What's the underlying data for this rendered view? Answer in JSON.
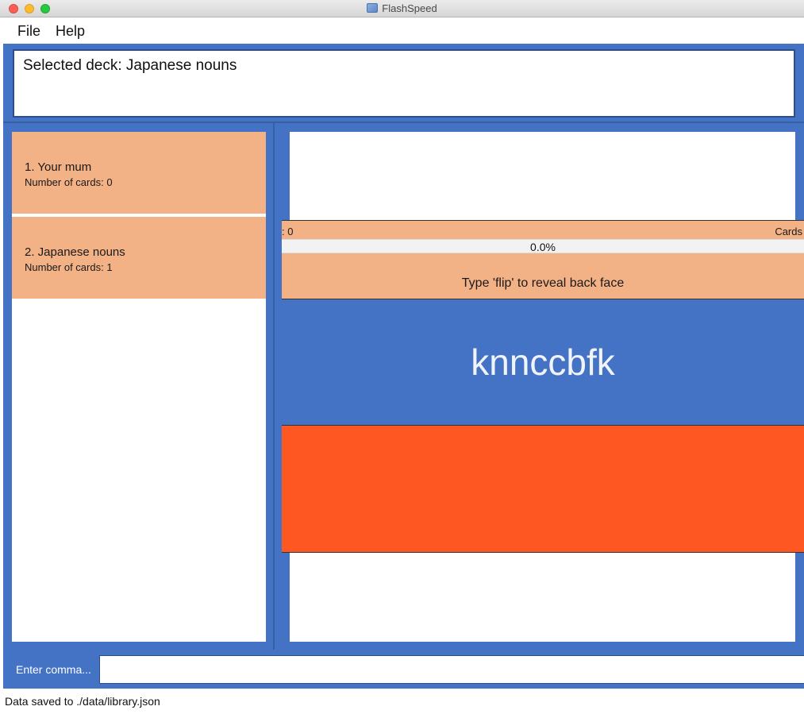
{
  "window": {
    "title": "FlashSpeed",
    "app_icon": "flashspeed-app-icon"
  },
  "menu": {
    "file": "File",
    "help": "Help"
  },
  "result": {
    "text": "Selected deck: Japanese nouns"
  },
  "decks": [
    {
      "name": "1.  Your mum",
      "count": "Number of cards: 0"
    },
    {
      "name": "2.  Japanese nouns",
      "count": "Number of cards: 1"
    }
  ],
  "review": {
    "stat_left": ": 0",
    "stat_right": "Cards",
    "progress": 0.0,
    "progress_label": "0.0%",
    "hint": "Type 'flip' to reveal back face",
    "front": "knnccbfk",
    "back": ""
  },
  "command": {
    "placeholder": "Enter comma...",
    "value": ""
  },
  "status": {
    "text": "Data saved to ./data/library.json"
  },
  "colors": {
    "primary": "#4473c5",
    "deck_card": "#f3b186",
    "back_face": "#ff5722",
    "front_text": "#f0f3f8"
  }
}
